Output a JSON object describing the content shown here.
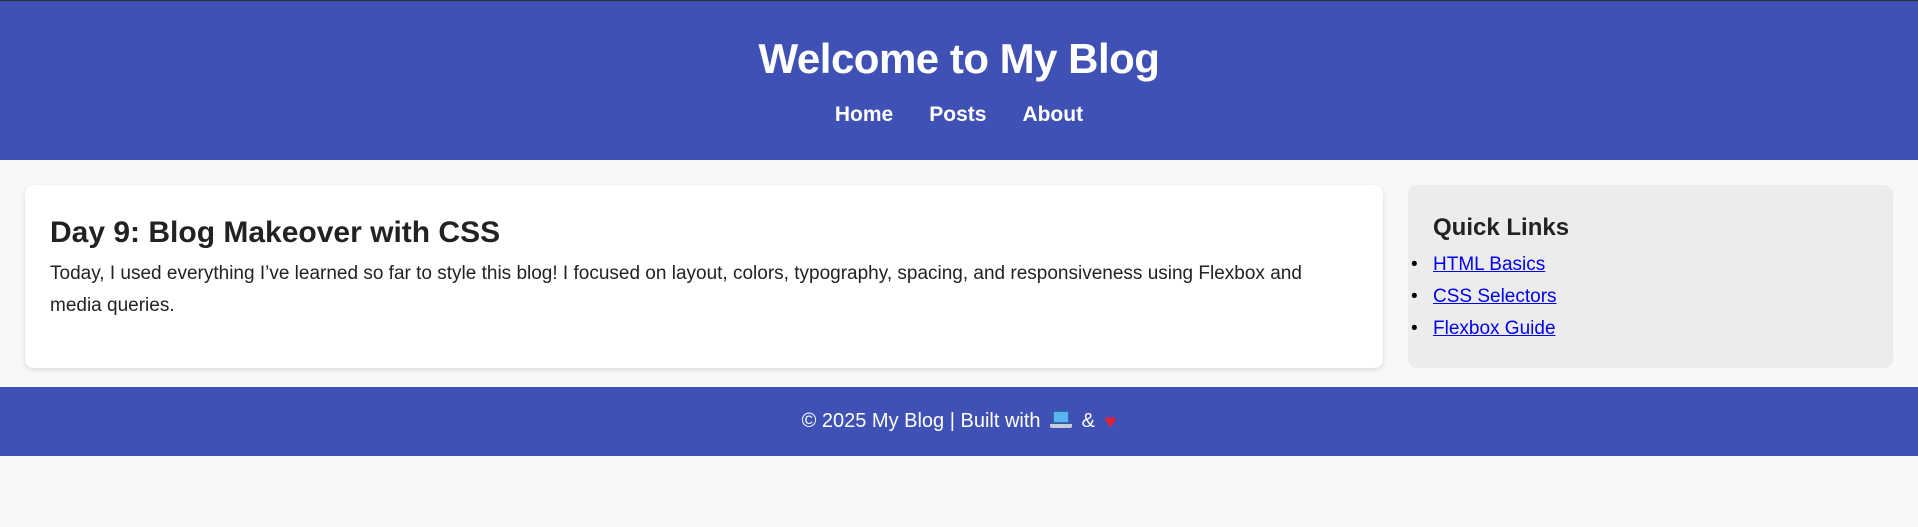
{
  "header": {
    "title": "Welcome to My Blog",
    "nav": [
      {
        "label": "Home"
      },
      {
        "label": "Posts"
      },
      {
        "label": "About"
      }
    ]
  },
  "post": {
    "title": "Day 9: Blog Makeover with CSS",
    "body": "Today, I used everything I’ve learned so far to style this blog! I focused on layout, colors, typography, spacing, and responsiveness using Flexbox and media queries."
  },
  "sidebar": {
    "title": "Quick Links",
    "links": [
      {
        "label": "HTML Basics"
      },
      {
        "label": "CSS Selectors"
      },
      {
        "label": "Flexbox Guide"
      }
    ]
  },
  "footer": {
    "text": "© 2025 My Blog | Built with",
    "ampersand": "&",
    "icons": [
      "laptop-icon",
      "heart-icon"
    ]
  },
  "colors": {
    "header_bg": "#3f51b5",
    "footer_bg": "#3f51b5",
    "page_bg": "#f8f8f8",
    "card_bg": "#ffffff",
    "sidebar_bg": "#ececec",
    "link": "#0000ee",
    "heart": "#e0213a"
  }
}
